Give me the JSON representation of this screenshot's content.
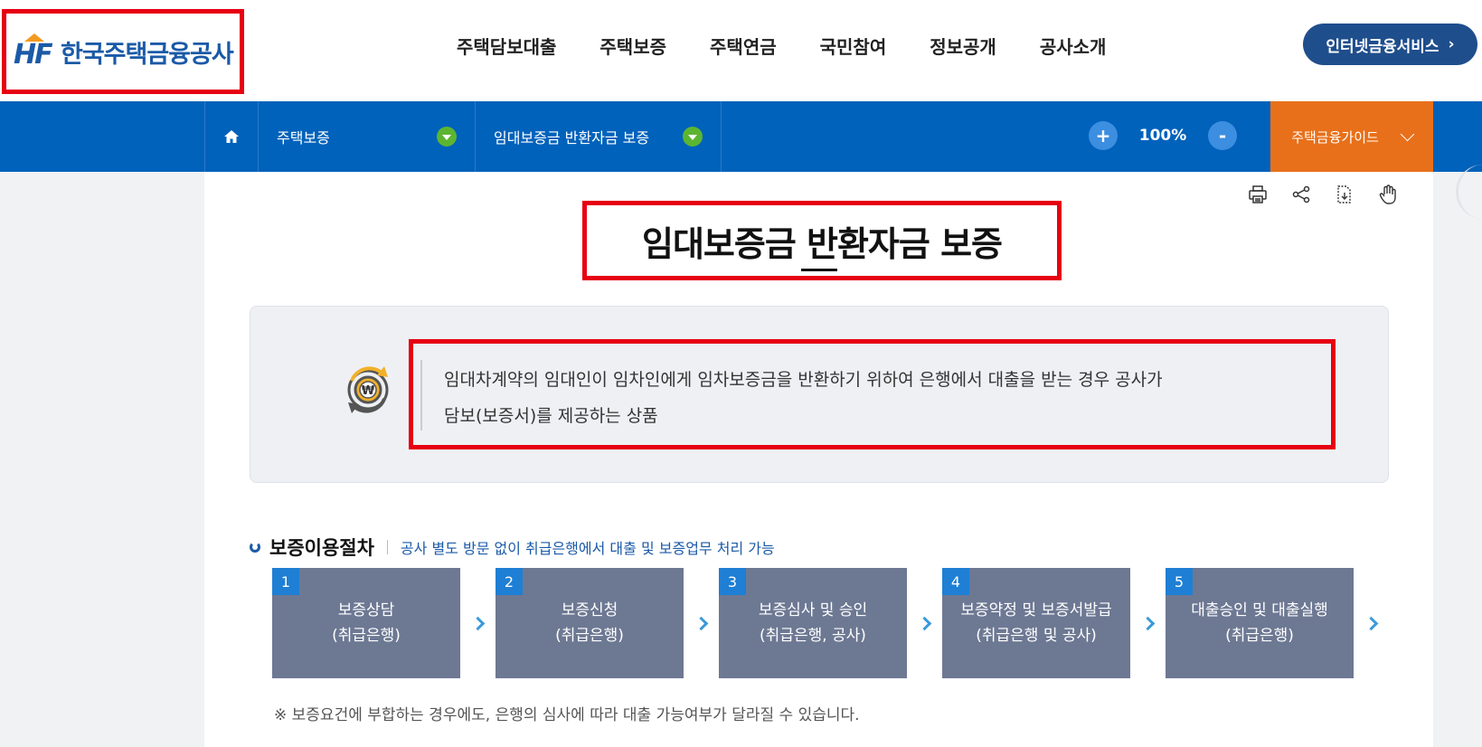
{
  "header": {
    "logo_mark": "HF",
    "logo_text": "한국주택금융공사",
    "nav": [
      "주택담보대출",
      "주택보증",
      "주택연금",
      "국민참여",
      "정보공개",
      "공사소개"
    ],
    "internet_button": "인터넷금융서비스",
    "internet_button_arrow": "›"
  },
  "location": {
    "home_icon": "home-icon",
    "crumb1": "주택보증",
    "crumb2": "임대보증금 반환자금 보증",
    "zoom_plus": "+",
    "zoom_value": "100%",
    "zoom_minus": "-",
    "guide_label": "주택금융가이드"
  },
  "utility_icons": [
    "print-icon",
    "share-icon",
    "download-icon",
    "hand-pointer-icon"
  ],
  "page": {
    "title": "임대보증금 반환자금 보증",
    "intro_line1": "임대차계약의 임대인이 임차인에게 임차보증금을 반환하기 위하여 은행에서 대출을 받는 경우 공사가",
    "intro_line2": "담보(보증서)를 제공하는 상품"
  },
  "procedure": {
    "title": "보증이용절차",
    "subtitle": "공사 별도 방문 없이 취급은행에서 대출 및 보증업무 처리 가능",
    "steps": [
      {
        "num": "1",
        "line1": "보증상담",
        "line2": "(취급은행)"
      },
      {
        "num": "2",
        "line1": "보증신청",
        "line2": "(취급은행)"
      },
      {
        "num": "3",
        "line1": "보증심사 및 승인",
        "line2": "(취급은행, 공사)"
      },
      {
        "num": "4",
        "line1": "보증약정 및 보증서발급",
        "line2": "(취급은행 및 공사)"
      },
      {
        "num": "5",
        "line1": "대출승인 및 대출실행",
        "line2": "(취급은행)"
      }
    ],
    "note": "※ 보증요건에 부합하는 경우에도, 은행의 심사에 따라 대출 가능여부가 달라질 수 있습니다."
  },
  "colors": {
    "brand_blue": "#0062bb",
    "guide_orange": "#e8701a",
    "highlight_red": "#e60012",
    "step_gray": "#6d7893",
    "step_num_blue": "#1e7fd4"
  }
}
